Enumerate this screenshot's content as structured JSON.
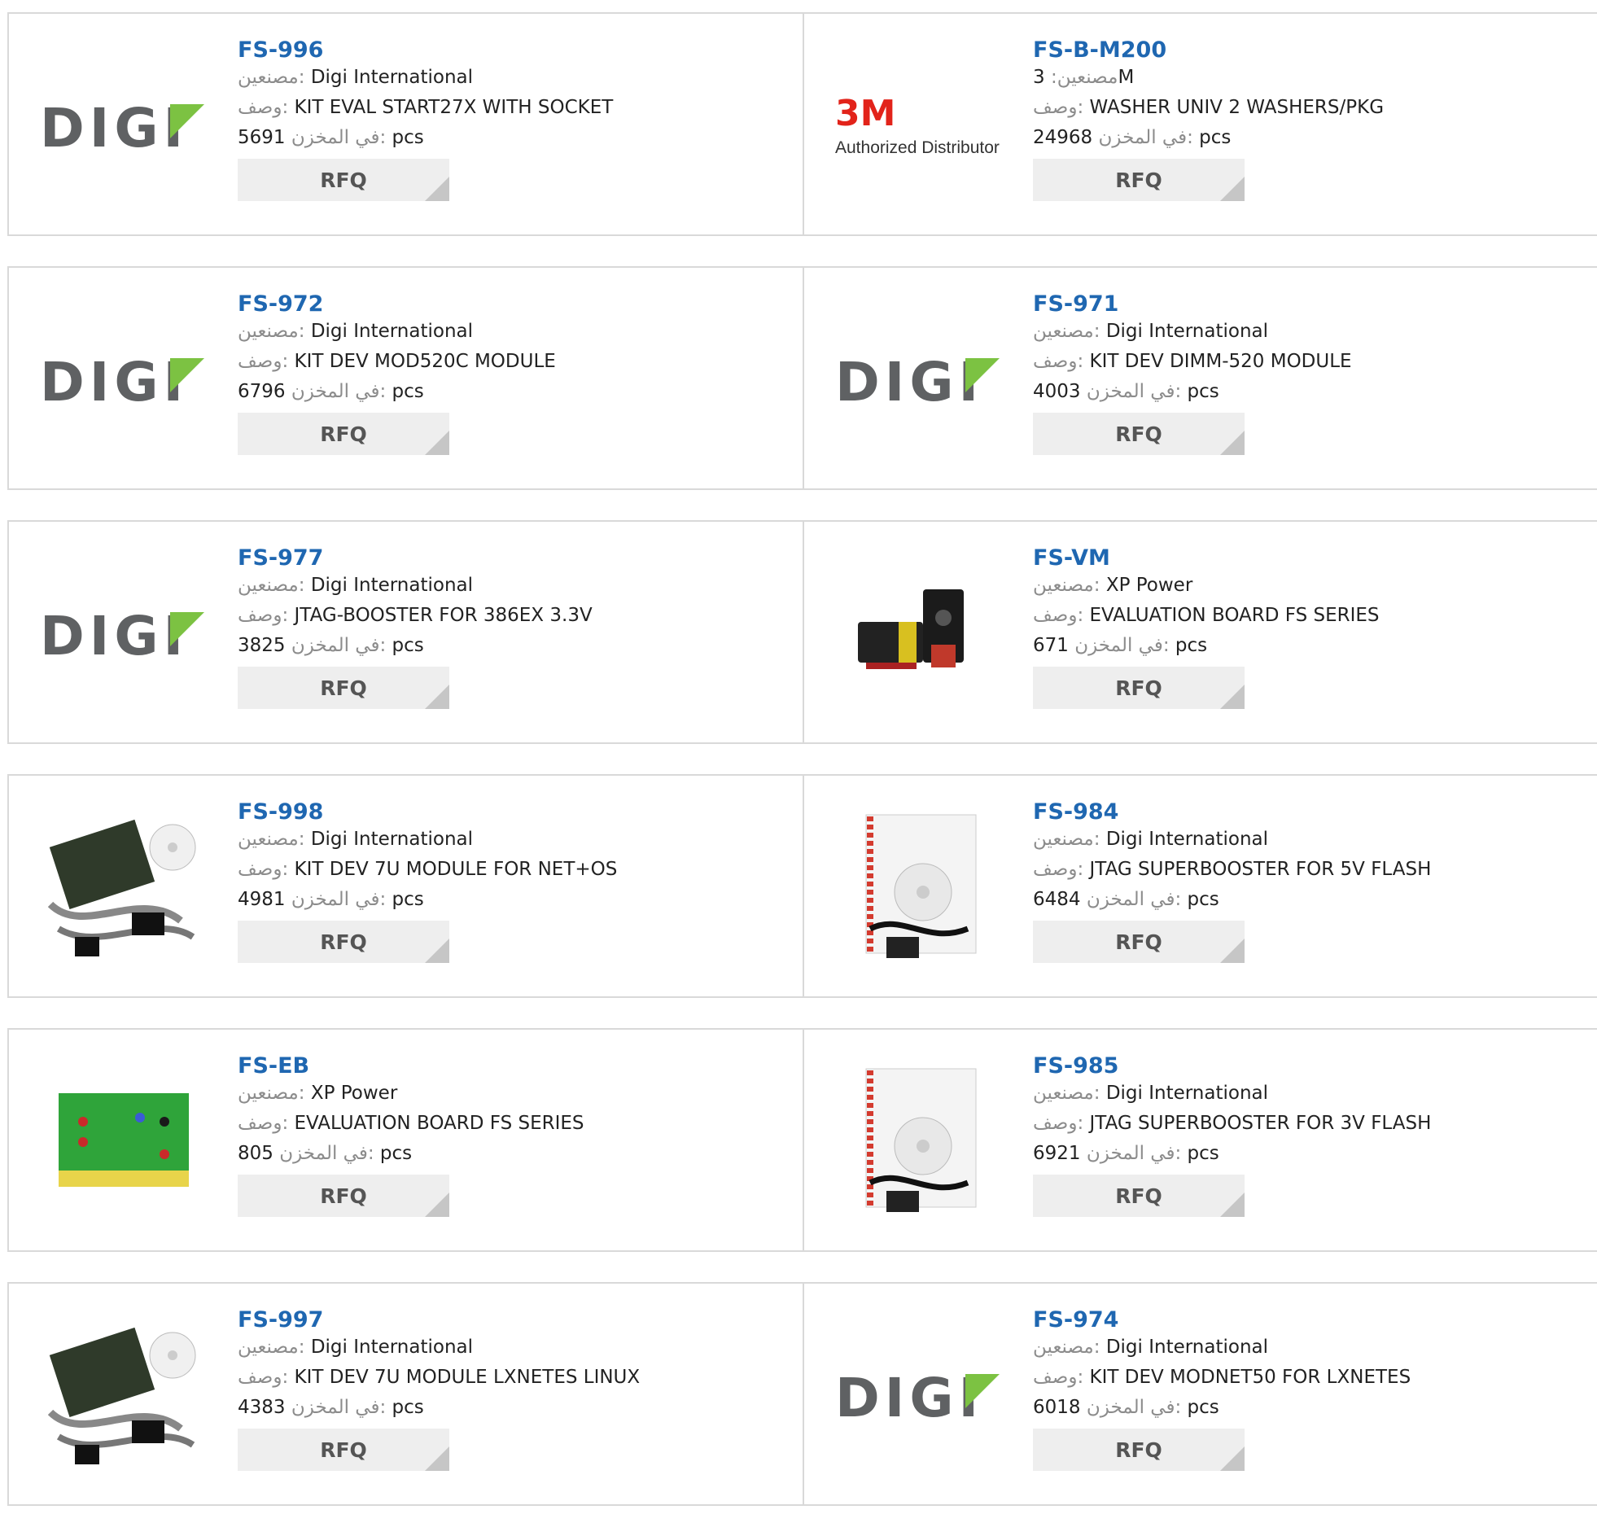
{
  "labels": {
    "manufacturer": "مصنعين:",
    "description": "وصف:",
    "stock": "في المخزن:",
    "unit": "pcs",
    "rfq": "RFQ"
  },
  "colors": {
    "part_link": "#1f67b1",
    "digi_green": "#7cc242",
    "digi_gray": "#5f6163",
    "brand_3m_red": "#e2231a"
  },
  "products": [
    {
      "part": "FS-996",
      "manufacturer": "Digi International",
      "description": "KIT EVAL START27X WITH SOCKET",
      "stock": "5691",
      "image": "digi-logo"
    },
    {
      "part": "FS-B-M200",
      "manufacturer": "3M",
      "description": "WASHER UNIV 2 WASHERS/PKG",
      "stock": "24968",
      "image": "3m-logo",
      "logo_text": "3M",
      "logo_caption": "Authorized Distributor"
    },
    {
      "part": "FS-972",
      "manufacturer": "Digi International",
      "description": "KIT DEV MOD520C MODULE",
      "stock": "6796",
      "image": "digi-logo"
    },
    {
      "part": "FS-971",
      "manufacturer": "Digi International",
      "description": "KIT DEV DIMM-520 MODULE",
      "stock": "4003",
      "image": "digi-logo"
    },
    {
      "part": "FS-977",
      "manufacturer": "Digi International",
      "description": "JTAG-BOOSTER FOR 386EX 3.3V",
      "stock": "3825",
      "image": "digi-logo"
    },
    {
      "part": "FS-VM",
      "manufacturer": "XP Power",
      "description": "EVALUATION BOARD FS SERIES",
      "stock": "671",
      "image": "power-module-photo"
    },
    {
      "part": "FS-998",
      "manufacturer": "Digi International",
      "description": "KIT DEV 7U MODULE FOR NET+OS",
      "stock": "4981",
      "image": "dev-kit-photo"
    },
    {
      "part": "FS-984",
      "manufacturer": "Digi International",
      "description": "JTAG SUPERBOOSTER FOR 5V FLASH",
      "stock": "6484",
      "image": "manual-cable-photo"
    },
    {
      "part": "FS-EB",
      "manufacturer": "XP Power",
      "description": "EVALUATION BOARD FS SERIES",
      "stock": "805",
      "image": "green-board-photo"
    },
    {
      "part": "FS-985",
      "manufacturer": "Digi International",
      "description": "JTAG SUPERBOOSTER FOR 3V FLASH",
      "stock": "6921",
      "image": "manual-cable-photo"
    },
    {
      "part": "FS-997",
      "manufacturer": "Digi International",
      "description": "KIT DEV 7U MODULE LXNETES LINUX",
      "stock": "4383",
      "image": "dev-kit-photo"
    },
    {
      "part": "FS-974",
      "manufacturer": "Digi International",
      "description": "KIT DEV MODNET50 FOR LXNETES",
      "stock": "6018",
      "image": "digi-logo"
    }
  ]
}
